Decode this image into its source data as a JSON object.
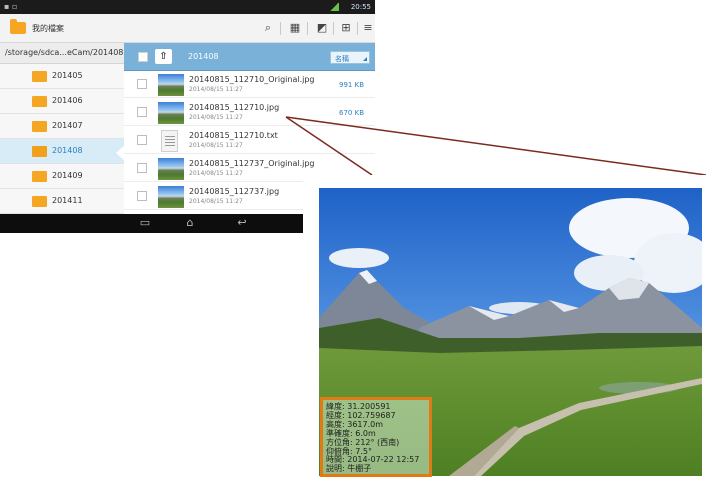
{
  "status_bar": {
    "time": "20:55"
  },
  "action_bar": {
    "app_title": "我的檔案",
    "buttons": [
      "search-icon",
      "grid-view-icon",
      "image-share-icon",
      "add-folder-icon",
      "overflow-menu-icon"
    ]
  },
  "path": "/storage/sdca...eCam/201408",
  "folders": [
    {
      "label": "201405",
      "active": false
    },
    {
      "label": "201406",
      "active": false
    },
    {
      "label": "201407",
      "active": false
    },
    {
      "label": "201408",
      "active": true
    },
    {
      "label": "201409",
      "active": false
    },
    {
      "label": "201411",
      "active": false
    }
  ],
  "file_header": {
    "folder": "201408",
    "sort": "名稱"
  },
  "files": [
    {
      "name": "20140815_112710_Original.jpg",
      "date": "2014/08/15 11:27",
      "size": "991 KB",
      "type": "image"
    },
    {
      "name": "20140815_112710.jpg",
      "date": "2014/08/15 11:27",
      "size": "670 KB",
      "type": "image"
    },
    {
      "name": "20140815_112710.txt",
      "date": "2014/08/15 11:27",
      "size": "",
      "type": "text"
    },
    {
      "name": "20140815_112737_Original.jpg",
      "date": "2014/08/15 11:27",
      "size": "",
      "type": "image"
    },
    {
      "name": "20140815_112737.jpg",
      "date": "2014/08/15 11:27",
      "size": "",
      "type": "image"
    }
  ],
  "nav_bar": [
    "recent-apps-icon",
    "home-icon",
    "back-icon"
  ],
  "exif": [
    "緯度: 31.200591",
    "經度: 102.759687",
    "高度: 3617.0m",
    "準確度: 6.0m",
    "方位角: 212° (西南)",
    "仰俯角: 7.5°",
    "時間: 2014-07-22 12:57",
    "說明: 牛棚子"
  ],
  "colors": {
    "accent": "#7ab1d8",
    "folder": "#f5a623",
    "connector": "#7b2a1e",
    "exif_border": "#e07a15"
  }
}
